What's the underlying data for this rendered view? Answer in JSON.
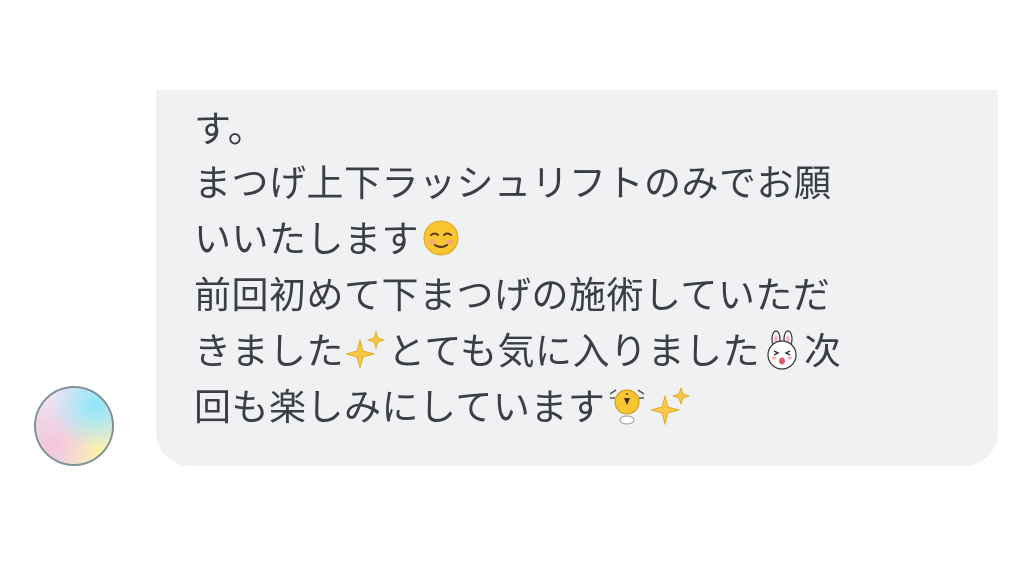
{
  "chat": {
    "message": {
      "line1": "す。",
      "line2": "まつげ上下ラッシュリフトのみでお願",
      "line3": "いいたします",
      "line4": "前回初めて下まつげの施術していただ",
      "line5a": "きました",
      "line5b": "とても気に入りました",
      "line5c": "次",
      "line6": "回も楽しみにしています"
    },
    "emoji": {
      "smile": "relieved-face-icon",
      "sparkles": "sparkles-icon",
      "bunny": "cony-bunny-sticker-icon",
      "chick": "excited-chick-sticker-icon"
    }
  },
  "colors": {
    "bubble_bg": "#f0f1f3",
    "text": "#3b3f45",
    "avatar_border": "#7f9196"
  }
}
